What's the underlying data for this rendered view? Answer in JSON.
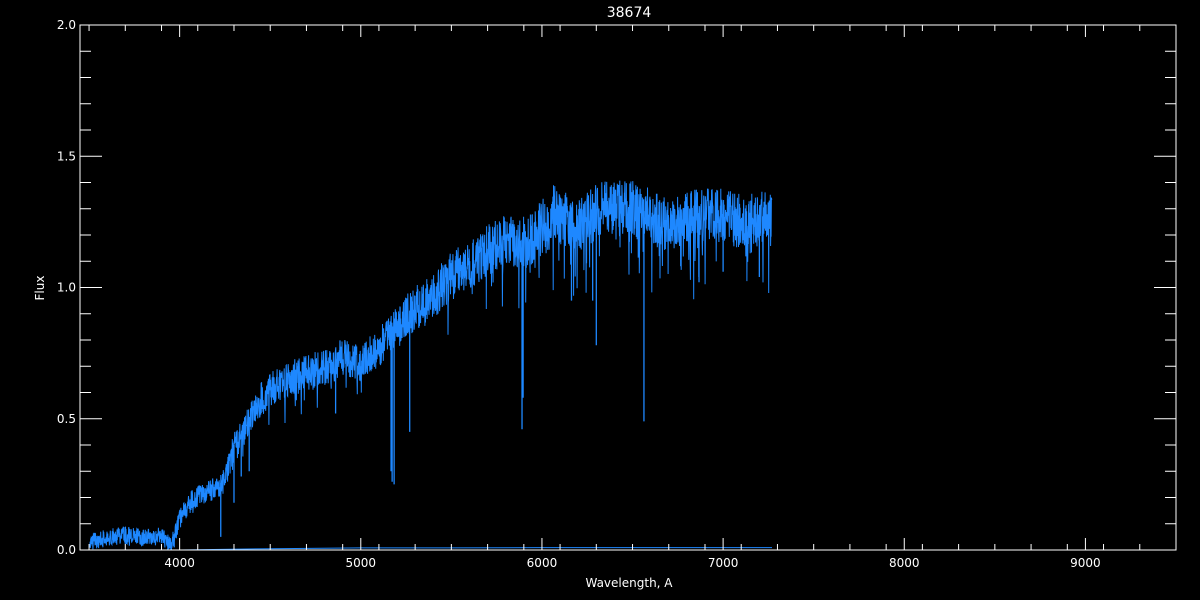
{
  "chart_data": {
    "type": "line",
    "title": "38674",
    "xlabel": "Wavelength, A",
    "ylabel": "Flux",
    "xlim": [
      3450,
      9500
    ],
    "ylim": [
      0,
      2.0
    ],
    "x_ticks": [
      4000,
      5000,
      6000,
      7000,
      8000,
      9000
    ],
    "x_tick_labels": [
      "4000",
      "5000",
      "6000",
      "7000",
      "8000",
      "9000"
    ],
    "y_ticks": [
      0,
      0.5,
      1.0,
      1.5,
      2.0
    ],
    "y_tick_labels": [
      "0.0",
      "0.5",
      "1.0",
      "1.5",
      "2.0"
    ],
    "grid": false,
    "background": "#000000",
    "axis_color": "#ffffff",
    "series": [
      {
        "color": "#1e88ff",
        "x": [
          3500,
          3600,
          3700,
          3800,
          3900,
          3950,
          4000,
          4050,
          4100,
          4200,
          4250,
          4300,
          4350,
          4400,
          4450,
          4500,
          4600,
          4700,
          4800,
          4900,
          5000,
          5100,
          5200,
          5250,
          5300,
          5400,
          5500,
          5600,
          5700,
          5800,
          5900,
          6000,
          6050,
          6100,
          6200,
          6300,
          6400,
          6500,
          6600,
          6700,
          6800,
          6900,
          7000,
          7100,
          7200,
          7270
        ],
        "y": [
          0.03,
          0.05,
          0.06,
          0.05,
          0.06,
          0.02,
          0.12,
          0.18,
          0.21,
          0.24,
          0.27,
          0.4,
          0.45,
          0.52,
          0.58,
          0.62,
          0.66,
          0.68,
          0.7,
          0.74,
          0.72,
          0.78,
          0.86,
          0.9,
          0.93,
          0.98,
          1.05,
          1.1,
          1.15,
          1.2,
          1.18,
          1.24,
          1.3,
          1.28,
          1.25,
          1.3,
          1.33,
          1.31,
          1.28,
          1.25,
          1.27,
          1.29,
          1.28,
          1.26,
          1.27,
          1.27
        ]
      },
      {
        "color": "#1e88ff",
        "x": [
          3500,
          4000,
          4500,
          5000,
          5500,
          6000,
          6500,
          7000,
          7270
        ],
        "y": [
          0.0,
          0.0,
          0.005,
          0.008,
          0.008,
          0.009,
          0.009,
          0.009,
          0.009
        ]
      }
    ],
    "absorption_lines": [
      {
        "x": 3935,
        "y": 0.0
      },
      {
        "x": 3970,
        "y": 0.01
      },
      {
        "x": 4227,
        "y": 0.05
      },
      {
        "x": 4300,
        "y": 0.18
      },
      {
        "x": 4340,
        "y": 0.28
      },
      {
        "x": 4384,
        "y": 0.3
      },
      {
        "x": 4861,
        "y": 0.52
      },
      {
        "x": 5167,
        "y": 0.3
      },
      {
        "x": 5173,
        "y": 0.26
      },
      {
        "x": 5184,
        "y": 0.25
      },
      {
        "x": 5270,
        "y": 0.45
      },
      {
        "x": 5890,
        "y": 0.46
      },
      {
        "x": 5896,
        "y": 0.58
      },
      {
        "x": 6163,
        "y": 0.95
      },
      {
        "x": 6280,
        "y": 0.95
      },
      {
        "x": 6300,
        "y": 0.78
      },
      {
        "x": 6563,
        "y": 0.49
      },
      {
        "x": 6867,
        "y": 1.02
      },
      {
        "x": 7000,
        "y": 1.06
      },
      {
        "x": 7200,
        "y": 1.04
      }
    ]
  }
}
